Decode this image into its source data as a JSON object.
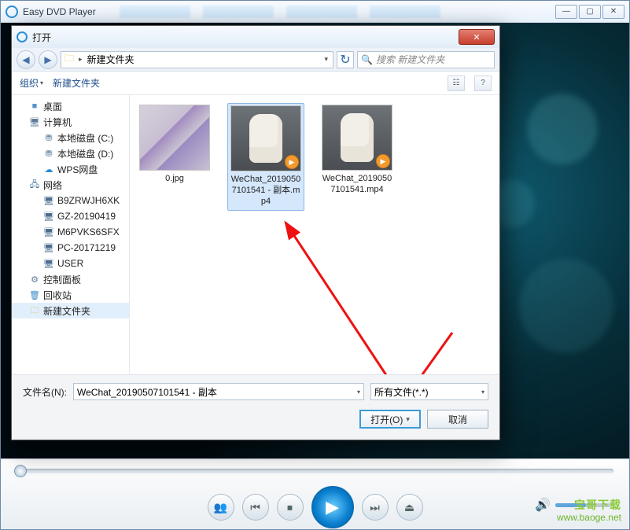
{
  "app": {
    "title": "Easy DVD Player",
    "window_controls": {
      "min": "—",
      "max": "▢",
      "close": "✕"
    }
  },
  "dialog": {
    "title": "打开",
    "close": "✕",
    "nav": {
      "back": "◀",
      "fwd": "▶"
    },
    "breadcrumb": {
      "folder_icon": "🗀",
      "current": "新建文件夹",
      "drop": "▾"
    },
    "refresh": "↻",
    "search": {
      "placeholder": "搜索 新建文件夹",
      "icon": "🔍"
    },
    "toolbar": {
      "organize": "组织",
      "organize_caret": "▾",
      "newfolder": "新建文件夹",
      "view_icon": "☷",
      "help_icon": "?"
    },
    "tree": [
      {
        "icon": "■",
        "cls": "ti-desktop",
        "label": "桌面",
        "indent": 0
      },
      {
        "icon": "🖥",
        "cls": "ti-computer",
        "label": "计算机",
        "indent": 0
      },
      {
        "icon": "⛃",
        "cls": "ti-drive",
        "label": "本地磁盘 (C:)",
        "indent": 1
      },
      {
        "icon": "⛃",
        "cls": "ti-drive",
        "label": "本地磁盘 (D:)",
        "indent": 1
      },
      {
        "icon": "☁",
        "cls": "ti-cloud",
        "label": "WPS网盘",
        "indent": 1
      },
      {
        "icon": "🖧",
        "cls": "ti-network",
        "label": "网络",
        "indent": 0
      },
      {
        "icon": "🖥",
        "cls": "ti-pc",
        "label": "B9ZRWJH6XK",
        "indent": 1
      },
      {
        "icon": "🖥",
        "cls": "ti-pc",
        "label": "GZ-20190419",
        "indent": 1
      },
      {
        "icon": "🖥",
        "cls": "ti-pc",
        "label": "M6PVKS6SFX",
        "indent": 1
      },
      {
        "icon": "🖥",
        "cls": "ti-pc",
        "label": "PC-20171219",
        "indent": 1
      },
      {
        "icon": "🖥",
        "cls": "ti-pc",
        "label": "USER",
        "indent": 1
      },
      {
        "icon": "⚙",
        "cls": "ti-ctrl",
        "label": "控制面板",
        "indent": 0
      },
      {
        "icon": "🗑",
        "cls": "ti-recycle",
        "label": "回收站",
        "indent": 0
      },
      {
        "icon": "🗀",
        "cls": "ti-folder",
        "label": "新建文件夹",
        "indent": 0,
        "selected": true
      }
    ],
    "files": [
      {
        "name": "0.jpg",
        "kind": "image",
        "selected": false
      },
      {
        "name": "WeChat_20190507101541 - 副本.mp4",
        "kind": "video",
        "selected": true
      },
      {
        "name": "WeChat_20190507101541.mp4",
        "kind": "video",
        "selected": false
      }
    ],
    "footer": {
      "filename_label": "文件名(N):",
      "filename_value": "WeChat_20190507101541 - 副本",
      "filetype": "所有文件(*.*)",
      "caret": "▾",
      "open": "打开(O)",
      "cancel": "取消"
    }
  },
  "player": {
    "buttons": {
      "people": "👥",
      "prev": "⏮",
      "stop": "⏹",
      "play": "▶",
      "next": "⏭",
      "eject": "⏏",
      "volume_icon": "🔊"
    }
  },
  "watermark": {
    "cn": "宝哥下载",
    "url": "www.baoge.net"
  }
}
